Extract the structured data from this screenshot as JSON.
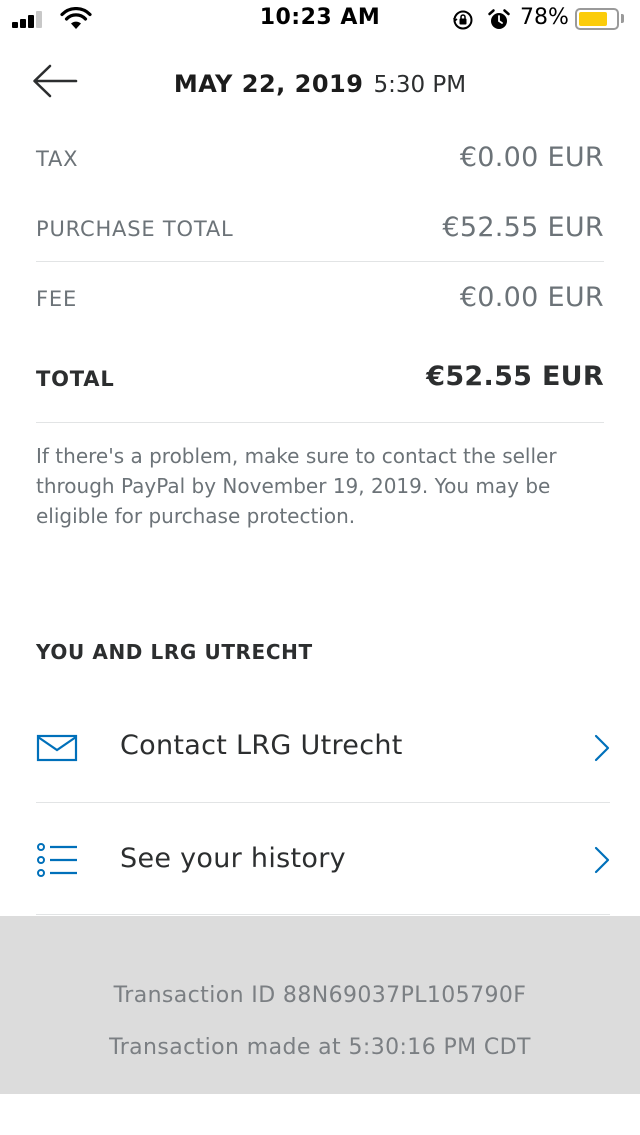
{
  "status_bar": {
    "time": "10:23 AM",
    "battery_percent": "78%",
    "battery_level": 0.78,
    "battery_color": "#fbcc0a",
    "signal_icon": "cellular-signal-icon",
    "wifi_icon": "wifi-icon",
    "rotation_icon": "rotation-lock-icon",
    "alarm_icon": "alarm-clock-icon"
  },
  "header": {
    "back_icon": "back-arrow-icon",
    "date": "MAY 22, 2019",
    "time": "5:30 PM"
  },
  "summary": {
    "tax": {
      "label": "TAX",
      "value": "€0.00 EUR"
    },
    "purchase_total": {
      "label": "PURCHASE TOTAL",
      "value": "€52.55 EUR"
    },
    "fee": {
      "label": "FEE",
      "value": "€0.00 EUR"
    },
    "total": {
      "label": "TOTAL",
      "value": "€52.55 EUR"
    }
  },
  "note": "If there's a problem, make sure to contact the seller through PayPal by November 19, 2019. You may be eligible for purchase protection.",
  "section": {
    "title": "YOU AND LRG UTRECHT",
    "items": [
      {
        "label": "Contact LRG Utrecht",
        "icon": "envelope-icon"
      },
      {
        "label": "See your history",
        "icon": "list-icon"
      }
    ]
  },
  "accent_color": "#0070ba",
  "footer": {
    "transaction_id": "Transaction ID 88N69037PL105790F",
    "transaction_time": "Transaction made at 5:30:16 PM CDT"
  }
}
